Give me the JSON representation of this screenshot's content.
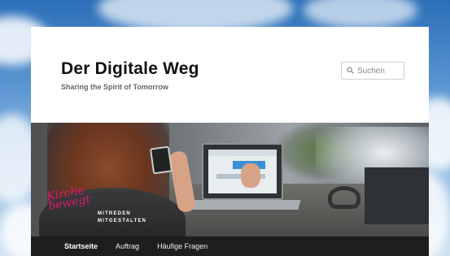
{
  "site": {
    "title": "Der Digitale Weg",
    "tagline": "Sharing the Spirit of Tomorrow"
  },
  "search": {
    "placeholder": "Suchen",
    "icon": "search-icon"
  },
  "hero": {
    "logo_script": "Kirche bewegt",
    "logo_lines": [
      "MITREDEN",
      "MITGESTALTEN"
    ]
  },
  "nav": {
    "items": [
      {
        "label": "Startseite",
        "active": true
      },
      {
        "label": "Auftrag",
        "active": false
      },
      {
        "label": "Häufige Fragen",
        "active": false
      }
    ]
  },
  "colors": {
    "accent": "#e0186f",
    "nav_bg": "#1e1e1e"
  }
}
